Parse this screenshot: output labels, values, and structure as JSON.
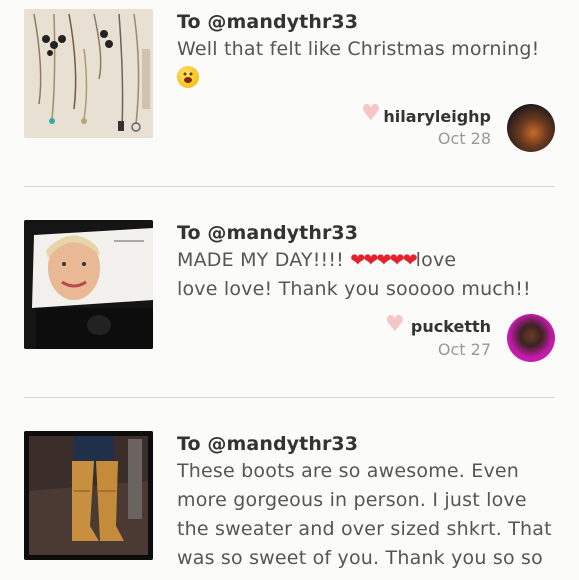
{
  "feed": [
    {
      "to": "To @mandythr33",
      "message_parts": [
        "Well that felt like Christmas morning!"
      ],
      "emoji": "grinning-face",
      "username": "hilaryleighp",
      "date": "Oct 28"
    },
    {
      "to": "To @mandythr33",
      "message_line1_a": "MADE MY DAY!!!!",
      "message_hearts": "❤❤❤❤❤",
      "message_line1_b": "love",
      "message_line2": "love love! Thank you sooooo much!!",
      "username": "pucketth",
      "date": "Oct 27"
    },
    {
      "to": "To @mandythr33",
      "message_lines": [
        "These boots are so awesome. Even",
        "more gorgeous in person. I just love",
        "the sweater and over sized shkrt. That",
        "was so sweet of you. Thank you so so"
      ]
    }
  ],
  "colors": {
    "heart_like": "#f6c5c8",
    "heart_red": "#e5212c",
    "date_grey": "#999999",
    "divider": "#d9d9d5"
  }
}
